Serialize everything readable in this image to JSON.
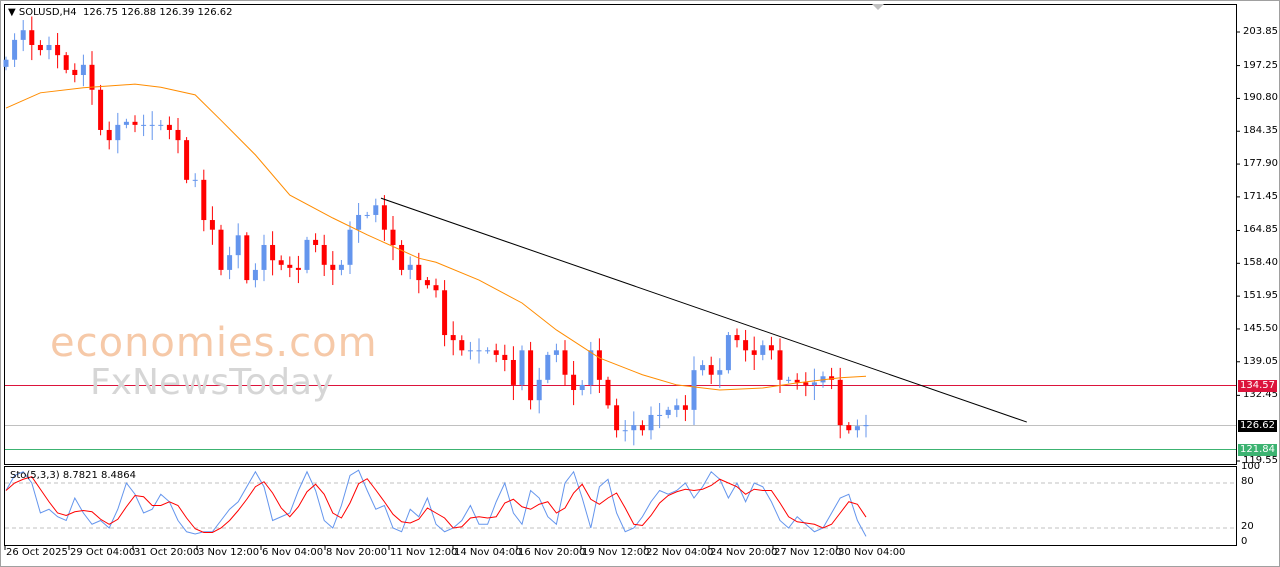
{
  "header": {
    "symbol": "SOLUSD,H4",
    "ohlc": "126.75 126.88 126.39 126.62"
  },
  "watermark": {
    "line1": "economies.com",
    "line2": "FxNewsToday"
  },
  "price_axis": [
    "203.85",
    "197.25",
    "190.80",
    "184.35",
    "177.90",
    "171.45",
    "164.85",
    "158.40",
    "151.95",
    "145.50",
    "139.05",
    "132.45",
    "119.55"
  ],
  "time_axis": [
    "26 Oct 2025",
    "29 Oct 04:00",
    "31 Oct 20:00",
    "3 Nov 12:00",
    "6 Nov 04:00",
    "8 Nov 20:00",
    "11 Nov 12:00",
    "14 Nov 04:00",
    "16 Nov 20:00",
    "19 Nov 12:00",
    "22 Nov 04:00",
    "24 Nov 20:00",
    "27 Nov 12:00",
    "30 Nov 04:00"
  ],
  "levels": [
    {
      "label": "134.57",
      "value": 134.57,
      "color": "#dc143c",
      "tag_text": "#ffffff"
    },
    {
      "label": "126.62",
      "value": 126.62,
      "color": "#c0c0c0",
      "tag_bg": "#000000"
    },
    {
      "label": "121.84",
      "value": 121.84,
      "color": "#3cb371",
      "tag_text": "#ffffff"
    }
  ],
  "stochastic": {
    "title": "Sto(5,3,3) 8.7821 8.4864",
    "axis": [
      "100",
      "80",
      "20",
      "0"
    ],
    "k": [
      70,
      90,
      95,
      80,
      40,
      45,
      35,
      30,
      60,
      40,
      25,
      30,
      20,
      45,
      80,
      65,
      40,
      45,
      65,
      55,
      30,
      15,
      12,
      15,
      15,
      30,
      45,
      55,
      75,
      95,
      75,
      30,
      35,
      40,
      70,
      95,
      70,
      30,
      20,
      50,
      90,
      97,
      70,
      45,
      50,
      20,
      15,
      45,
      35,
      60,
      25,
      15,
      20,
      30,
      50,
      25,
      25,
      55,
      80,
      40,
      25,
      70,
      60,
      35,
      25,
      80,
      95,
      60,
      20,
      75,
      85,
      40,
      15,
      20,
      35,
      55,
      70,
      65,
      70,
      80,
      60,
      75,
      95,
      85,
      60,
      80,
      55,
      80,
      75,
      55,
      30,
      20,
      35,
      25,
      15,
      20,
      40,
      60,
      65,
      30,
      8.78
    ],
    "colors": {
      "k": "#6495ed",
      "d": "#ff0000"
    }
  },
  "chart_data": {
    "type": "candlestick",
    "title": "SOLUSD,H4",
    "ylim": [
      119.55,
      203.85
    ],
    "colors": {
      "bull": "#6495ed",
      "bear": "#ff0000",
      "ma": "#ff8c00",
      "trendline": "#000000"
    },
    "closes": [
      198.4,
      202.3,
      204.2,
      201.3,
      200.3,
      201.3,
      199.3,
      196.4,
      195.4,
      197.4,
      192.5,
      184.6,
      182.6,
      185.6,
      186.2,
      185.6,
      185.6,
      185.6,
      185.6,
      184.6,
      182.6,
      174.8,
      174.8,
      166.9,
      165.0,
      157.1,
      160.0,
      163.9,
      155.1,
      157.1,
      162.0,
      159.0,
      158.1,
      157.5,
      157.1,
      163.0,
      162.0,
      158.1,
      157.1,
      158.1,
      165.0,
      167.9,
      167.9,
      169.8,
      165.0,
      162.0,
      157.1,
      158.1,
      155.1,
      154.1,
      153.1,
      144.3,
      143.3,
      141.3,
      141.3,
      141.3,
      141.3,
      140.4,
      139.4,
      134.5,
      141.3,
      131.5,
      135.5,
      140.4,
      141.3,
      136.5,
      133.5,
      134.5,
      141.3,
      135.5,
      130.5,
      125.6,
      125.6,
      126.6,
      125.6,
      128.6,
      128.6,
      129.6,
      130.5,
      129.6,
      137.4,
      138.4,
      136.5,
      137.4,
      144.3,
      143.3,
      141.3,
      140.4,
      142.3,
      141.3,
      135.5,
      135.5,
      135.0,
      134.5,
      135.0,
      136.2,
      135.5,
      126.6,
      125.6,
      126.4,
      126.62
    ],
    "first_open": 197.0,
    "moving_average": [
      [
        0,
        188.9
      ],
      [
        4,
        191.9
      ],
      [
        9,
        192.9
      ],
      [
        15,
        193.6
      ],
      [
        18,
        193.0
      ],
      [
        22,
        191.5
      ],
      [
        25,
        186.5
      ],
      [
        29,
        179.7
      ],
      [
        33,
        171.8
      ],
      [
        38,
        167.3
      ],
      [
        42,
        164.0
      ],
      [
        48,
        159.4
      ],
      [
        50,
        158.6
      ],
      [
        55,
        155.1
      ],
      [
        60,
        150.6
      ],
      [
        64,
        145.3
      ],
      [
        69,
        139.8
      ],
      [
        74,
        136.5
      ],
      [
        78,
        134.5
      ],
      [
        83,
        133.5
      ],
      [
        88,
        133.9
      ],
      [
        92,
        134.9
      ],
      [
        97,
        135.9
      ],
      [
        100,
        136.2
      ]
    ],
    "trendline": [
      [
        43.6,
        171.2
      ],
      [
        118.7,
        127.2
      ]
    ]
  }
}
